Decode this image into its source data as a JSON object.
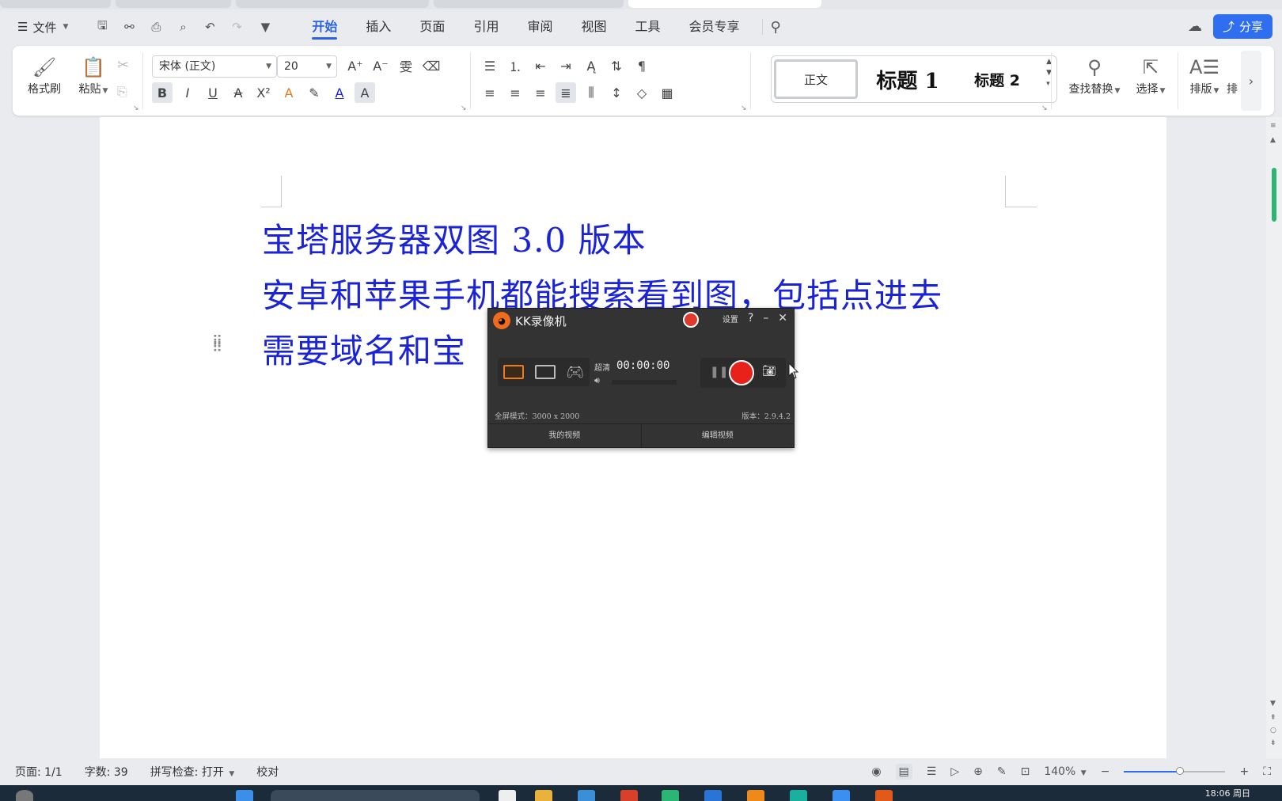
{
  "menu": {
    "file_label": "文件",
    "tabs": [
      "开始",
      "插入",
      "页面",
      "引用",
      "审阅",
      "视图",
      "工具",
      "会员专享"
    ],
    "active_tab": "开始",
    "share_label": "分享"
  },
  "ribbon": {
    "format_painter": "格式刷",
    "paste": "粘贴",
    "font_name": "宋体 (正文)",
    "font_size": "20",
    "styles": {
      "normal": "正文",
      "heading1": "标题 1",
      "heading2": "标题 2"
    },
    "find_replace": "查找替换",
    "select": "选择",
    "layout": "排版",
    "layout_cut": "排"
  },
  "document": {
    "lines": [
      "宝塔服务器双图 3.0 版本",
      "安卓和苹果手机都能搜索看到图，包括点进去",
      "需要域名和宝"
    ]
  },
  "recorder": {
    "title": "KK录像机",
    "settings": "设置",
    "help": "?",
    "quality": "超清",
    "timer": "00:00:00",
    "mode_info": "全屏模式：3000 x 2000",
    "version": "版本：2.9.4.2",
    "my_videos": "我的视频",
    "edit_video": "编辑视频"
  },
  "status": {
    "page": "页面: 1/1",
    "words": "字数: 39",
    "spell": "拼写检查: 打开",
    "proof": "校对",
    "zoom": "140%",
    "zoom_fraction": 0.55
  },
  "taskbar": {
    "clock": "18:06 周日"
  },
  "colors": {
    "accent": "#2a64e0",
    "doc_text": "#1a23d6",
    "record_red": "#e8211b",
    "scroll_green": "#2bb673"
  }
}
